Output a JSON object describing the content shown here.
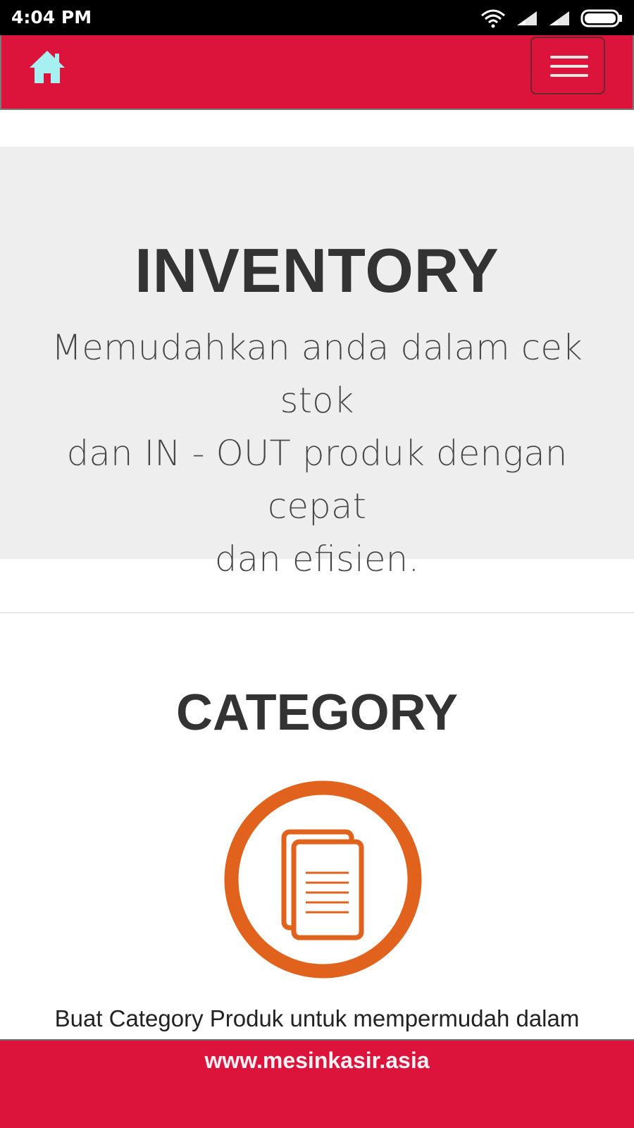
{
  "status": {
    "time": "4:04 PM",
    "icons": [
      "wifi-icon",
      "signal-icon",
      "signal-icon",
      "battery-icon"
    ]
  },
  "navbar": {
    "home_icon": "home-icon",
    "menu_icon": "hamburger-menu-icon",
    "accent_color": "#dc143c"
  },
  "hero": {
    "title": "INVENTORY",
    "subtitle_lines": [
      "Memudahkan anda dalam cek stok",
      "dan IN - OUT produk dengan cepat",
      "dan efisien."
    ]
  },
  "category": {
    "title": "CATEGORY",
    "icon": "documents-icon",
    "icon_color": "#e0621c",
    "description": "Buat Category Produk untuk mempermudah dalam"
  },
  "footer": {
    "link": "www.mesinkasir.asia"
  }
}
